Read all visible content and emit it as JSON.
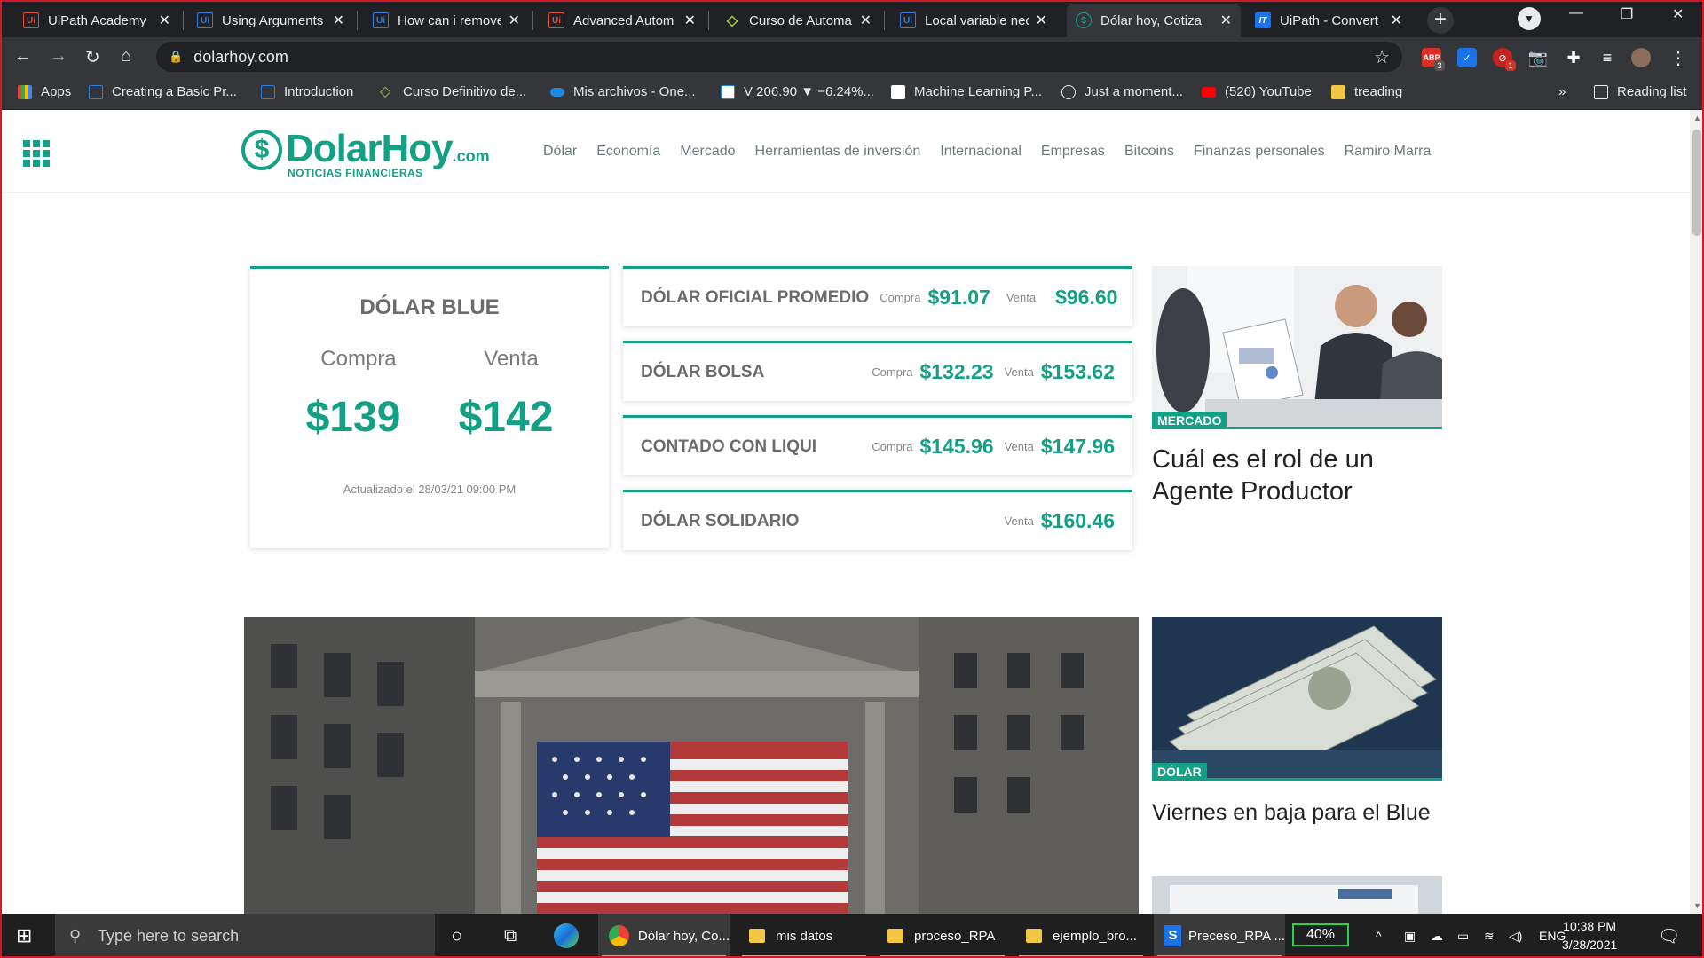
{
  "browser": {
    "tabs": [
      {
        "label": "UiPath Academy",
        "icon": "uipath-icon"
      },
      {
        "label": "Using Arguments",
        "icon": "uipath-icon"
      },
      {
        "label": "How can i remove",
        "icon": "uipath-icon"
      },
      {
        "label": "Advanced Autom",
        "icon": "uipath-icon"
      },
      {
        "label": "Curso de Automa",
        "icon": "diamond-icon"
      },
      {
        "label": "Local variable nec",
        "icon": "uipath-icon"
      },
      {
        "label": "Dólar hoy, Cotiza",
        "icon": "dolarhoy-icon"
      },
      {
        "label": "UiPath - Convert",
        "icon": "it-icon"
      }
    ],
    "url": "dolarhoy.com",
    "bookmarks": [
      {
        "label": "Apps"
      },
      {
        "label": "Creating a Basic Pr..."
      },
      {
        "label": "Introduction"
      },
      {
        "label": "Curso Definitivo de..."
      },
      {
        "label": "Mis archivos - One..."
      },
      {
        "label": "V 206.90 ▼ −6.24%..."
      },
      {
        "label": "Machine Learning P..."
      },
      {
        "label": "Just a moment..."
      },
      {
        "label": "(526) YouTube"
      },
      {
        "label": "treading"
      }
    ],
    "bookmarks_more": "»",
    "reading_list": "Reading list",
    "extension_badges": {
      "abp": "3",
      "red": "1"
    }
  },
  "site": {
    "logo": {
      "brand": "DolarHoy",
      "tld": ".com",
      "tagline": "NOTICIAS FINANCIERAS"
    },
    "menu": [
      "Dólar",
      "Economía",
      "Mercado",
      "Herramientas de inversión",
      "Internacional",
      "Empresas",
      "Bitcoins",
      "Finanzas personales",
      "Ramiro Marra"
    ],
    "blue": {
      "title": "DÓLAR BLUE",
      "compra_label": "Compra",
      "venta_label": "Venta",
      "compra": "$139",
      "venta": "$142",
      "updated": "Actualizado el 28/03/21 09:00 PM"
    },
    "quotes": [
      {
        "name": "DÓLAR OFICIAL PROMEDIO",
        "compra_label": "Compra",
        "compra": "$91.07",
        "venta_label": "Venta",
        "venta": "$96.60"
      },
      {
        "name": "DÓLAR BOLSA",
        "compra_label": "Compra",
        "compra": "$132.23",
        "venta_label": "Venta",
        "venta": "$153.62"
      },
      {
        "name": "CONTADO CON LIQUI",
        "compra_label": "Compra",
        "compra": "$145.96",
        "venta_label": "Venta",
        "venta": "$147.96"
      },
      {
        "name": "DÓLAR SOLIDARIO",
        "venta_label": "Venta",
        "venta": "$160.46"
      }
    ],
    "articles": [
      {
        "tag": "MERCADO",
        "title": "Cuál es el rol de un Agente Productor"
      },
      {
        "tag": "DÓLAR",
        "title": "Viernes en baja para el Blue"
      }
    ]
  },
  "taskbar": {
    "search_placeholder": "Type here to search",
    "apps": [
      {
        "label": "Dólar hoy, Co..."
      },
      {
        "label": "mis datos"
      },
      {
        "label": "proceso_RPA"
      },
      {
        "label": "ejemplo_bro..."
      },
      {
        "label": "Preceso_RPA ..."
      }
    ],
    "battery": "40%",
    "language": "ENG",
    "time": "10:38 PM",
    "date": "3/28/2021"
  },
  "colors": {
    "accent": "#14a085",
    "chrome_dark": "#202124",
    "chrome": "#35363a"
  }
}
